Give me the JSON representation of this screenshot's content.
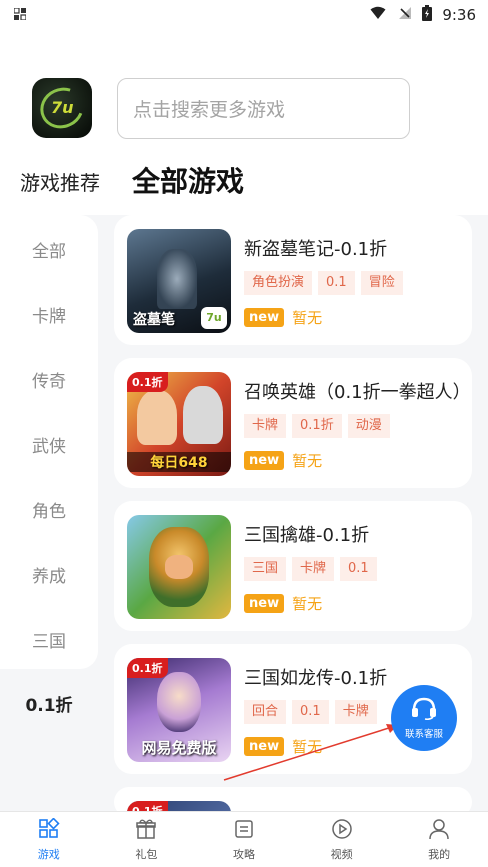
{
  "status_bar": {
    "left_icon": "notification-icon",
    "time": "9:36"
  },
  "header": {
    "search_placeholder": "点击搜索更多游戏"
  },
  "tabs": {
    "recommend": "游戏推荐",
    "all": "全部游戏"
  },
  "categories": [
    "全部",
    "卡牌",
    "传奇",
    "武侠",
    "角色",
    "养成",
    "三国"
  ],
  "active_category": "0.1折",
  "games": [
    {
      "title": "新盗墓笔记-0.1折",
      "tags": [
        "角色扮演",
        "0.1",
        "冒险"
      ],
      "new": "new",
      "status": "暂无",
      "thumb_text": "盗墓笔"
    },
    {
      "title": "召唤英雄（0.1折一拳超人）",
      "tags": [
        "卡牌",
        "0.1折",
        "动漫"
      ],
      "new": "new",
      "status": "暂无",
      "thumb_text": "每日648",
      "thumb_badge": "0.1折"
    },
    {
      "title": "三国擒雄-0.1折",
      "tags": [
        "三国",
        "卡牌",
        "0.1"
      ],
      "new": "new",
      "status": "暂无"
    },
    {
      "title": "三国如龙传-0.1折",
      "tags": [
        "回合",
        "0.1",
        "卡牌"
      ],
      "new": "new",
      "status": "暂无",
      "thumb_text": "网易免费版",
      "thumb_badge": "0.1折"
    },
    {
      "thumb_badge": "0.1折"
    }
  ],
  "float_button": {
    "label": "联系客服"
  },
  "bottom_nav": [
    {
      "label": "游戏",
      "icon": "games-icon"
    },
    {
      "label": "礼包",
      "icon": "gift-icon"
    },
    {
      "label": "攻略",
      "icon": "guide-icon"
    },
    {
      "label": "视频",
      "icon": "video-icon"
    },
    {
      "label": "我的",
      "icon": "profile-icon"
    }
  ],
  "colors": {
    "accent": "#1f7ef3",
    "tag_text": "#e0674a",
    "tag_bg": "#fdeee9",
    "new_badge": "#f5a316"
  }
}
